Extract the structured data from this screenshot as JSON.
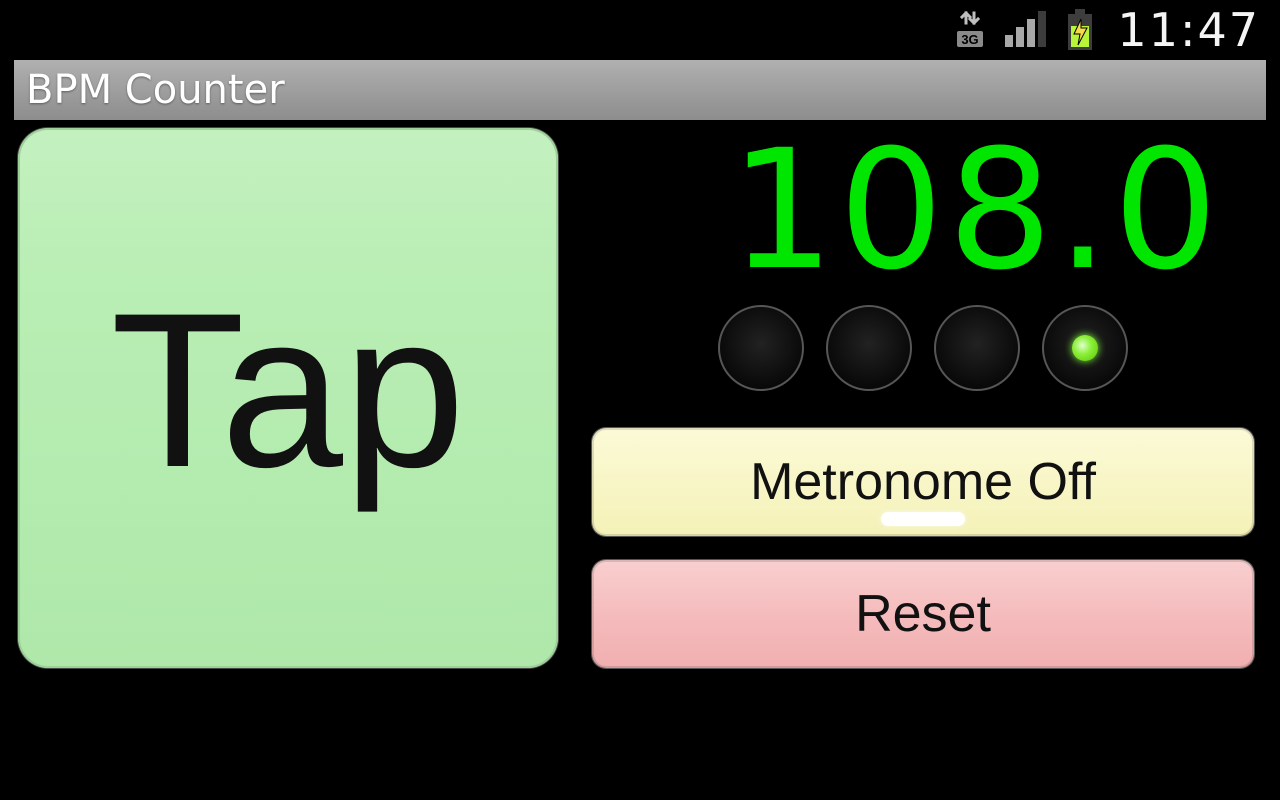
{
  "status": {
    "icons": {
      "network_3g": "3G",
      "signal": "signal-icon",
      "battery_charging": "battery-charging-icon"
    },
    "time": "11:47"
  },
  "title": "BPM Counter",
  "tap": {
    "label": "Tap"
  },
  "bpm": {
    "value": "108.0"
  },
  "beats": {
    "count": 4,
    "active_index": 3
  },
  "buttons": {
    "metronome": "Metronome Off",
    "reset": "Reset"
  },
  "colors": {
    "bpm": "#00e600",
    "tap_bg": "#b9eeb4",
    "metronome_bg": "#f8f6c7",
    "reset_bg": "#f5bcbd"
  }
}
